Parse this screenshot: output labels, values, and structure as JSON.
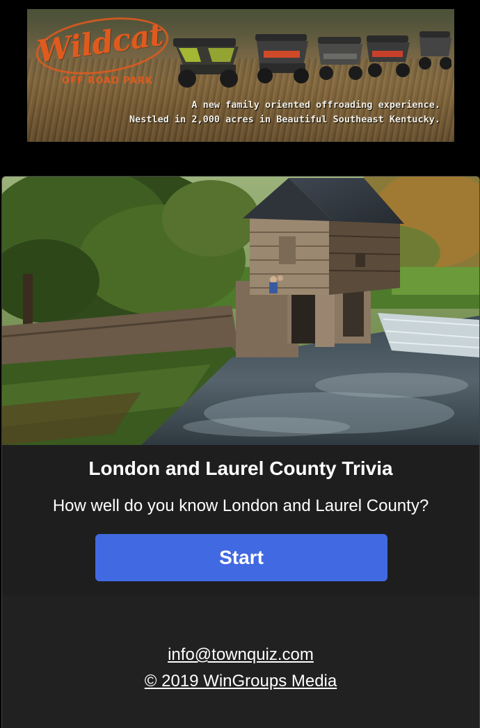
{
  "ad": {
    "brand": "Wildcat",
    "brand_sub": "OFF ROAD PARK",
    "line1": "A new family oriented offroading experience.",
    "line2": "Nestled in 2,000 acres in Beautiful Southeast Kentucky.",
    "accent_color": "#e05a1e"
  },
  "quiz": {
    "title": "London and Laurel County Trivia",
    "description": "How well do you know London and Laurel County?",
    "start_label": "Start",
    "button_color": "#4169e1"
  },
  "footer": {
    "email": "info@townquiz.com",
    "copyright": "© 2019 WinGroups Media"
  }
}
